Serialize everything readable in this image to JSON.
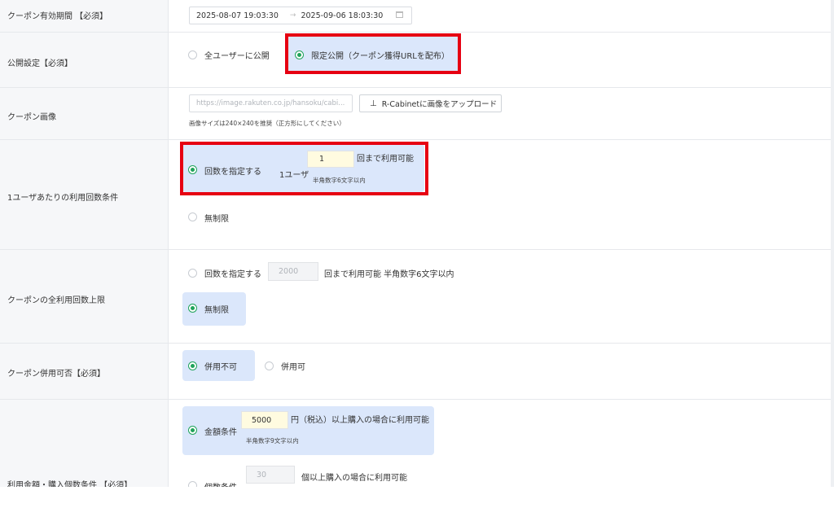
{
  "rows": {
    "validity": {
      "label": "クーポン有効期間 【必須】",
      "start": "2025-08-07 19:03:30",
      "arrow": "→",
      "end": "2025-09-06 18:03:30"
    },
    "publish": {
      "label": "公開設定【必須】",
      "opt_all": "全ユーザーに公開",
      "opt_limited": "限定公開（クーポン獲得URLを配布）",
      "selected": "limited"
    },
    "image": {
      "label": "クーポン画像",
      "url_placeholder": "https://image.rakuten.co.jp/hansoku/cabi...",
      "upload_label": "R-Cabinetに画像をアップロード",
      "size_hint": "画像サイズは240×240を推奨（正方形にしてください）"
    },
    "per_user": {
      "label": "1ユーザあたりの利用回数条件",
      "opt_specify": "回数を指定する",
      "prefix": "1ユーザ",
      "count_value": "1",
      "suffix": "回まで利用可能",
      "hint": "半角数字6文字以内",
      "opt_unlimited": "無制限",
      "selected": "specify"
    },
    "total": {
      "label": "クーポンの全利用回数上限",
      "opt_specify": "回数を指定する",
      "count_placeholder": "2000",
      "suffix": "回まで利用可能 半角数字6文字以内",
      "opt_unlimited": "無制限",
      "selected": "unlimited"
    },
    "combine": {
      "label": "クーポン併用可否【必須】",
      "opt_no": "併用不可",
      "opt_yes": "併用可",
      "selected": "no"
    },
    "amount": {
      "label": "利用金額・購入個数条件 【必須】",
      "opt_amount": "金額条件",
      "amount_value": "5000",
      "amount_suffix": "円（税込）以上購入の場合に利用可能",
      "amount_hint": "半角数字9文字以内",
      "opt_count": "個数条件",
      "count_placeholder": "30",
      "count_suffix": "個以上購入の場合に利用可能",
      "selected": "amount"
    }
  },
  "colors": {
    "accent": "#1fa35a",
    "highlight": "#dbe7fb",
    "annotation": "#e60012",
    "input_active": "#fffbe0"
  }
}
